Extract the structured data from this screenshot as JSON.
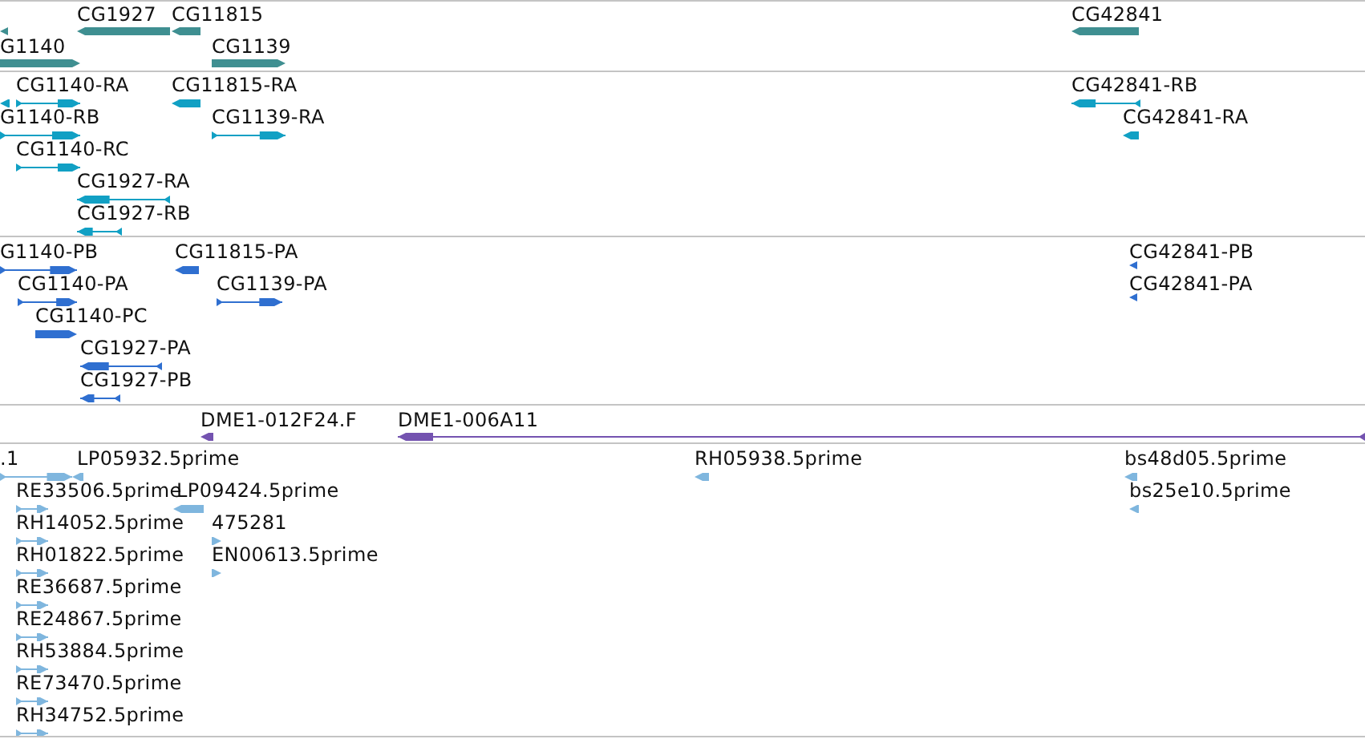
{
  "tracks": [
    {
      "kind": "gene",
      "features": [
        {
          "reverse": true
        },
        {
          "label": "CG1927",
          "reverse": true
        },
        {
          "label": "CG11815",
          "reverse": true
        },
        {
          "label": "G1140",
          "reverse": false
        },
        {
          "label": "CG1139",
          "reverse": false
        },
        {
          "label": "CG42841",
          "reverse": true
        }
      ]
    },
    {
      "kind": "transcript",
      "features": [
        {
          "reverse": true
        },
        {
          "label": "CG1140-RA",
          "reverse": false
        },
        {
          "label": "CG11815-RA",
          "reverse": true
        },
        {
          "label": "G1140-RB",
          "reverse": false
        },
        {
          "label": "CG1139-RA",
          "reverse": false
        },
        {
          "label": "CG1140-RC",
          "reverse": false
        },
        {
          "label": "CG1927-RA",
          "reverse": true
        },
        {
          "label": "CG1927-RB",
          "reverse": true
        },
        {
          "label": "CG42841-RB",
          "reverse": true
        },
        {
          "label": "CG42841-RA",
          "reverse": true
        }
      ]
    },
    {
      "kind": "protein",
      "features": [
        {
          "label": "G1140-PB",
          "reverse": false
        },
        {
          "label": "CG11815-PA",
          "reverse": true
        },
        {
          "label": "CG1140-PA",
          "reverse": false
        },
        {
          "label": "CG1139-PA",
          "reverse": false
        },
        {
          "label": "CG1140-PC",
          "reverse": false
        },
        {
          "label": "CG1927-PA",
          "reverse": true
        },
        {
          "label": "CG1927-PB",
          "reverse": true
        },
        {
          "label": "CG42841-PB",
          "reverse": true
        },
        {
          "label": "CG42841-PA",
          "reverse": true
        }
      ]
    },
    {
      "kind": "clone",
      "features": [
        {
          "label": "DME1-012F24.F",
          "reverse": true
        },
        {
          "label": "DME1-006A11",
          "reverse": true
        }
      ]
    },
    {
      "kind": "est",
      "features": [
        {
          "label": ".1",
          "reverse": false
        },
        {
          "label": "LP05932.5prime",
          "reverse": true
        },
        {
          "label": "RE33506.5prime",
          "reverse": false
        },
        {
          "label": "LP09424.5prime",
          "reverse": true
        },
        {
          "label": "RH14052.5prime",
          "reverse": false
        },
        {
          "label": "475281",
          "reverse": false
        },
        {
          "label": "RH01822.5prime",
          "reverse": false
        },
        {
          "label": "EN00613.5prime",
          "reverse": false
        },
        {
          "label": "RE36687.5prime",
          "reverse": false
        },
        {
          "label": "RE24867.5prime",
          "reverse": false
        },
        {
          "label": "RH53884.5prime",
          "reverse": false
        },
        {
          "label": "RE73470.5prime",
          "reverse": false
        },
        {
          "label": "RH34752.5prime",
          "reverse": false
        },
        {
          "label": "RH05938.5prime",
          "reverse": true
        },
        {
          "label": "bs48d05.5prime",
          "reverse": true
        },
        {
          "label": "bs25e10.5prime",
          "reverse": true
        }
      ]
    }
  ]
}
